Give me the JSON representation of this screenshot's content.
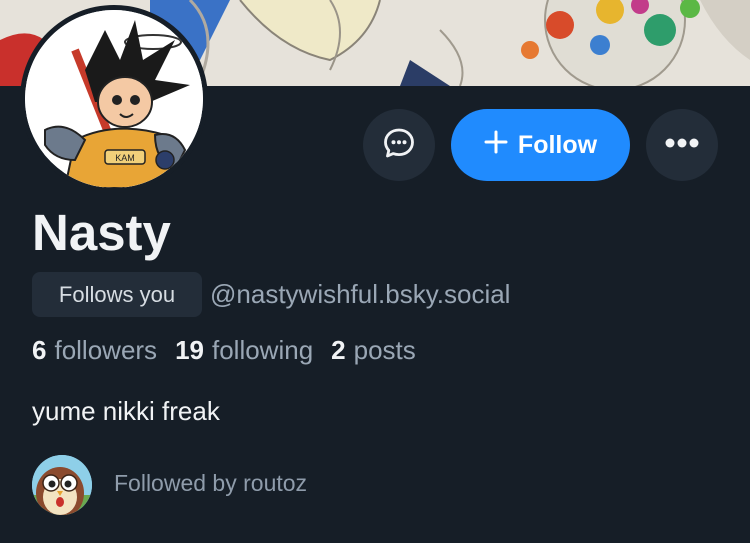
{
  "profile": {
    "display_name": "Nasty",
    "handle": "@nastywishful.bsky.social",
    "follows_you_badge": "Follows you",
    "bio": "yume nikki freak",
    "stats": {
      "followers_count": "6",
      "followers_label": "followers",
      "following_count": "19",
      "following_label": "following",
      "posts_count": "2",
      "posts_label": "posts"
    },
    "avatar_text": "KAM"
  },
  "actions": {
    "message_icon": "chat-bubble-icon",
    "follow_label": "Follow",
    "follow_icon": "plus-icon",
    "more_icon": "ellipsis-icon"
  },
  "social_proof": {
    "followed_by_text": "Followed by routoz",
    "avatar_icon": "owl-avatar"
  },
  "colors": {
    "background": "#161e27",
    "accent": "#208bfe",
    "button_bg": "#232d39",
    "text_primary": "#f1f3f5",
    "text_secondary": "#9aa7b5"
  }
}
